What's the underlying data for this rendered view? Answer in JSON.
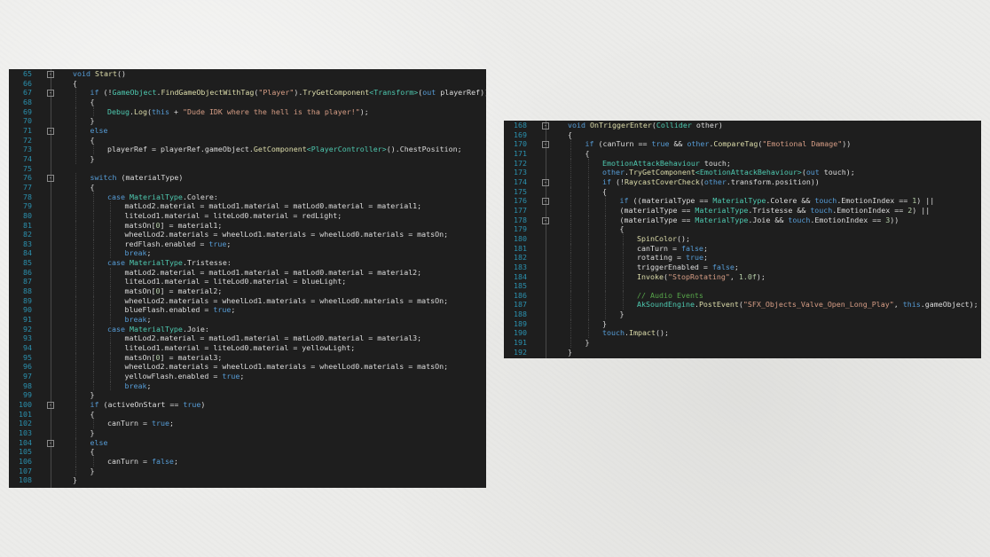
{
  "left_panel": {
    "lines": [
      {
        "n": "65",
        "indent": 0,
        "fold": "-",
        "tokens": [
          [
            "kw",
            "void "
          ],
          [
            "fn",
            "Start"
          ],
          [
            "pl",
            "()"
          ]
        ]
      },
      {
        "n": "66",
        "indent": 0,
        "tokens": [
          [
            "pl",
            "{"
          ]
        ]
      },
      {
        "n": "67",
        "indent": 1,
        "fold": "-",
        "tokens": [
          [
            "kw",
            "if "
          ],
          [
            "pl",
            "(!"
          ],
          [
            "ty",
            "GameObject"
          ],
          [
            "pl",
            "."
          ],
          [
            "fn",
            "FindGameObjectWithTag"
          ],
          [
            "pl",
            "("
          ],
          [
            "st",
            "\"Player\""
          ],
          [
            "pl",
            ")."
          ],
          [
            "fn",
            "TryGetComponent"
          ],
          [
            "ty",
            "<Transform>"
          ],
          [
            "pl",
            "("
          ],
          [
            "kw",
            "out "
          ],
          [
            "pl",
            "playerRef))"
          ]
        ]
      },
      {
        "n": "68",
        "indent": 1,
        "tokens": [
          [
            "pl",
            "{"
          ]
        ]
      },
      {
        "n": "69",
        "indent": 2,
        "tokens": [
          [
            "ty",
            "Debug"
          ],
          [
            "pl",
            "."
          ],
          [
            "fn",
            "Log"
          ],
          [
            "pl",
            "("
          ],
          [
            "kw",
            "this "
          ],
          [
            "pl",
            "+ "
          ],
          [
            "st",
            "\"Dude IDK where the hell is tha player!\""
          ],
          [
            "pl",
            ");"
          ]
        ]
      },
      {
        "n": "70",
        "indent": 1,
        "tokens": [
          [
            "pl",
            "}"
          ]
        ]
      },
      {
        "n": "71",
        "indent": 1,
        "fold": "-",
        "tokens": [
          [
            "kw",
            "else"
          ]
        ]
      },
      {
        "n": "72",
        "indent": 1,
        "tokens": [
          [
            "pl",
            "{"
          ]
        ]
      },
      {
        "n": "73",
        "indent": 2,
        "tokens": [
          [
            "pl",
            "playerRef = playerRef.gameObject."
          ],
          [
            "fn",
            "GetComponent"
          ],
          [
            "ty",
            "<PlayerController>"
          ],
          [
            "pl",
            "().ChestPosition;"
          ]
        ]
      },
      {
        "n": "74",
        "indent": 1,
        "tokens": [
          [
            "pl",
            "}"
          ]
        ]
      },
      {
        "n": "75",
        "indent": 0,
        "tokens": []
      },
      {
        "n": "76",
        "indent": 1,
        "fold": "-",
        "tokens": [
          [
            "kw",
            "switch "
          ],
          [
            "pl",
            "(materialType)"
          ]
        ]
      },
      {
        "n": "77",
        "indent": 1,
        "tokens": [
          [
            "pl",
            "{"
          ]
        ]
      },
      {
        "n": "78",
        "indent": 2,
        "tokens": [
          [
            "kw",
            "case "
          ],
          [
            "ty",
            "MaterialType"
          ],
          [
            "pl",
            ".Colere:"
          ]
        ]
      },
      {
        "n": "79",
        "indent": 3,
        "tokens": [
          [
            "pl",
            "matLod2.material = matLod1.material = matLod0.material = material1;"
          ]
        ]
      },
      {
        "n": "80",
        "indent": 3,
        "tokens": [
          [
            "pl",
            "liteLod1.material = liteLod0.material = redLight;"
          ]
        ]
      },
      {
        "n": "81",
        "indent": 3,
        "tokens": [
          [
            "pl",
            "matsOn["
          ],
          [
            "nm",
            "0"
          ],
          [
            "pl",
            "] = material1;"
          ]
        ]
      },
      {
        "n": "82",
        "indent": 3,
        "tokens": [
          [
            "pl",
            "wheelLod2.materials = wheelLod1.materials = wheelLod0.materials = matsOn;"
          ]
        ]
      },
      {
        "n": "83",
        "indent": 3,
        "tokens": [
          [
            "pl",
            "redFlash.enabled = "
          ],
          [
            "kw",
            "true"
          ],
          [
            "pl",
            ";"
          ]
        ]
      },
      {
        "n": "84",
        "indent": 3,
        "tokens": [
          [
            "kw",
            "break"
          ],
          [
            "pl",
            ";"
          ]
        ]
      },
      {
        "n": "85",
        "indent": 2,
        "tokens": [
          [
            "kw",
            "case "
          ],
          [
            "ty",
            "MaterialType"
          ],
          [
            "pl",
            ".Tristesse:"
          ]
        ]
      },
      {
        "n": "86",
        "indent": 3,
        "tokens": [
          [
            "pl",
            "matLod2.material = matLod1.material = matLod0.material = material2;"
          ]
        ]
      },
      {
        "n": "87",
        "indent": 3,
        "tokens": [
          [
            "pl",
            "liteLod1.material = liteLod0.material = blueLight;"
          ]
        ]
      },
      {
        "n": "88",
        "indent": 3,
        "tokens": [
          [
            "pl",
            "matsOn["
          ],
          [
            "nm",
            "0"
          ],
          [
            "pl",
            "] = material2;"
          ]
        ]
      },
      {
        "n": "89",
        "indent": 3,
        "tokens": [
          [
            "pl",
            "wheelLod2.materials = wheelLod1.materials = wheelLod0.materials = matsOn;"
          ]
        ]
      },
      {
        "n": "90",
        "indent": 3,
        "tokens": [
          [
            "pl",
            "blueFlash.enabled = "
          ],
          [
            "kw",
            "true"
          ],
          [
            "pl",
            ";"
          ]
        ]
      },
      {
        "n": "91",
        "indent": 3,
        "tokens": [
          [
            "kw",
            "break"
          ],
          [
            "pl",
            ";"
          ]
        ]
      },
      {
        "n": "92",
        "indent": 2,
        "tokens": [
          [
            "kw",
            "case "
          ],
          [
            "ty",
            "MaterialType"
          ],
          [
            "pl",
            ".Joie:"
          ]
        ]
      },
      {
        "n": "93",
        "indent": 3,
        "tokens": [
          [
            "pl",
            "matLod2.material = matLod1.material = matLod0.material = material3;"
          ]
        ]
      },
      {
        "n": "94",
        "indent": 3,
        "tokens": [
          [
            "pl",
            "liteLod1.material = liteLod0.material = yellowLight;"
          ]
        ]
      },
      {
        "n": "95",
        "indent": 3,
        "tokens": [
          [
            "pl",
            "matsOn["
          ],
          [
            "nm",
            "0"
          ],
          [
            "pl",
            "] = material3;"
          ]
        ]
      },
      {
        "n": "96",
        "indent": 3,
        "tokens": [
          [
            "pl",
            "wheelLod2.materials = wheelLod1.materials = wheelLod0.materials = matsOn;"
          ]
        ]
      },
      {
        "n": "97",
        "indent": 3,
        "tokens": [
          [
            "pl",
            "yellowFlash.enabled = "
          ],
          [
            "kw",
            "true"
          ],
          [
            "pl",
            ";"
          ]
        ]
      },
      {
        "n": "98",
        "indent": 3,
        "tokens": [
          [
            "kw",
            "break"
          ],
          [
            "pl",
            ";"
          ]
        ]
      },
      {
        "n": "99",
        "indent": 1,
        "tokens": [
          [
            "pl",
            "}"
          ]
        ]
      },
      {
        "n": "100",
        "indent": 1,
        "fold": "-",
        "tokens": [
          [
            "kw",
            "if "
          ],
          [
            "pl",
            "(activeOnStart == "
          ],
          [
            "kw",
            "true"
          ],
          [
            "pl",
            ")"
          ]
        ]
      },
      {
        "n": "101",
        "indent": 1,
        "tokens": [
          [
            "pl",
            "{"
          ]
        ]
      },
      {
        "n": "102",
        "indent": 2,
        "tokens": [
          [
            "pl",
            "canTurn = "
          ],
          [
            "kw",
            "true"
          ],
          [
            "pl",
            ";"
          ]
        ]
      },
      {
        "n": "103",
        "indent": 1,
        "tokens": [
          [
            "pl",
            "}"
          ]
        ]
      },
      {
        "n": "104",
        "indent": 1,
        "fold": "-",
        "tokens": [
          [
            "kw",
            "else"
          ]
        ]
      },
      {
        "n": "105",
        "indent": 1,
        "tokens": [
          [
            "pl",
            "{"
          ]
        ]
      },
      {
        "n": "106",
        "indent": 2,
        "tokens": [
          [
            "pl",
            "canTurn = "
          ],
          [
            "kw",
            "false"
          ],
          [
            "pl",
            ";"
          ]
        ]
      },
      {
        "n": "107",
        "indent": 1,
        "tokens": [
          [
            "pl",
            "}"
          ]
        ]
      },
      {
        "n": "108",
        "indent": 0,
        "tokens": [
          [
            "pl",
            "}"
          ]
        ]
      }
    ]
  },
  "right_panel": {
    "lines": [
      {
        "n": "168",
        "indent": 0,
        "fold": "-",
        "tokens": [
          [
            "kw",
            "void "
          ],
          [
            "fn",
            "OnTriggerEnter"
          ],
          [
            "pl",
            "("
          ],
          [
            "ty",
            "Collider "
          ],
          [
            "pl",
            "other)"
          ]
        ]
      },
      {
        "n": "169",
        "indent": 0,
        "tokens": [
          [
            "pl",
            "{"
          ]
        ]
      },
      {
        "n": "170",
        "indent": 1,
        "fold": "-",
        "tokens": [
          [
            "kw",
            "if "
          ],
          [
            "pl",
            "(canTurn == "
          ],
          [
            "kw",
            "true "
          ],
          [
            "pl",
            "&& "
          ],
          [
            "kw",
            "other"
          ],
          [
            "pl",
            "."
          ],
          [
            "fn",
            "CompareTag"
          ],
          [
            "pl",
            "("
          ],
          [
            "st",
            "\"Emotional Damage\""
          ],
          [
            "pl",
            "))"
          ]
        ]
      },
      {
        "n": "171",
        "indent": 1,
        "tokens": [
          [
            "pl",
            "{"
          ]
        ]
      },
      {
        "n": "172",
        "indent": 2,
        "tokens": [
          [
            "ty",
            "EmotionAttackBehaviour "
          ],
          [
            "pl",
            "touch;"
          ]
        ]
      },
      {
        "n": "173",
        "indent": 2,
        "tokens": [
          [
            "kw",
            "other"
          ],
          [
            "pl",
            "."
          ],
          [
            "fn",
            "TryGetComponent"
          ],
          [
            "ty",
            "<EmotionAttackBehaviour>"
          ],
          [
            "pl",
            "("
          ],
          [
            "kw",
            "out "
          ],
          [
            "pl",
            "touch);"
          ]
        ]
      },
      {
        "n": "174",
        "indent": 2,
        "fold": "-",
        "tokens": [
          [
            "kw",
            "if "
          ],
          [
            "pl",
            "(!"
          ],
          [
            "fn",
            "RaycastCoverCheck"
          ],
          [
            "pl",
            "("
          ],
          [
            "kw",
            "other"
          ],
          [
            "pl",
            ".transform.position))"
          ]
        ]
      },
      {
        "n": "175",
        "indent": 2,
        "tokens": [
          [
            "pl",
            "{"
          ]
        ]
      },
      {
        "n": "176",
        "indent": 3,
        "fold": "-",
        "tokens": [
          [
            "kw",
            "if "
          ],
          [
            "pl",
            "((materialType == "
          ],
          [
            "ty",
            "MaterialType"
          ],
          [
            "pl",
            ".Colere && "
          ],
          [
            "kw",
            "touch"
          ],
          [
            "pl",
            ".EmotionIndex == "
          ],
          [
            "nm",
            "1"
          ],
          [
            "pl",
            ") ||"
          ]
        ]
      },
      {
        "n": "177",
        "indent": 3,
        "tokens": [
          [
            "pl",
            "(materialType == "
          ],
          [
            "ty",
            "MaterialType"
          ],
          [
            "pl",
            ".Tristesse && "
          ],
          [
            "kw",
            "touch"
          ],
          [
            "pl",
            ".EmotionIndex == "
          ],
          [
            "nm",
            "2"
          ],
          [
            "pl",
            ") ||"
          ]
        ]
      },
      {
        "n": "178",
        "indent": 3,
        "fold": "-",
        "tokens": [
          [
            "pl",
            "(materialType == "
          ],
          [
            "ty",
            "MaterialType"
          ],
          [
            "pl",
            ".Joie && "
          ],
          [
            "kw",
            "touch"
          ],
          [
            "pl",
            ".EmotionIndex == "
          ],
          [
            "nm",
            "3"
          ],
          [
            "pl",
            "))"
          ]
        ]
      },
      {
        "n": "179",
        "indent": 3,
        "tokens": [
          [
            "pl",
            "{"
          ]
        ]
      },
      {
        "n": "180",
        "indent": 4,
        "tokens": [
          [
            "fn",
            "SpinColor"
          ],
          [
            "pl",
            "();"
          ]
        ]
      },
      {
        "n": "181",
        "indent": 4,
        "tokens": [
          [
            "pl",
            "canTurn = "
          ],
          [
            "kw",
            "false"
          ],
          [
            "pl",
            ";"
          ]
        ]
      },
      {
        "n": "182",
        "indent": 4,
        "tokens": [
          [
            "pl",
            "rotating = "
          ],
          [
            "kw",
            "true"
          ],
          [
            "pl",
            ";"
          ]
        ]
      },
      {
        "n": "183",
        "indent": 4,
        "tokens": [
          [
            "pl",
            "triggerEnabled = "
          ],
          [
            "kw",
            "false"
          ],
          [
            "pl",
            ";"
          ]
        ]
      },
      {
        "n": "184",
        "indent": 4,
        "tokens": [
          [
            "fn",
            "Invoke"
          ],
          [
            "pl",
            "("
          ],
          [
            "st",
            "\"StopRotating\""
          ],
          [
            "pl",
            ", "
          ],
          [
            "nm",
            "1.0f"
          ],
          [
            "pl",
            ");"
          ]
        ]
      },
      {
        "n": "185",
        "indent": 4,
        "tokens": []
      },
      {
        "n": "186",
        "indent": 4,
        "tokens": [
          [
            "cm",
            "// Audio Events"
          ]
        ]
      },
      {
        "n": "187",
        "indent": 4,
        "tokens": [
          [
            "ty",
            "AkSoundEngine"
          ],
          [
            "pl",
            "."
          ],
          [
            "fn",
            "PostEvent"
          ],
          [
            "pl",
            "("
          ],
          [
            "st",
            "\"SFX_Objects_Valve_Open_Long_Play\""
          ],
          [
            "pl",
            ", "
          ],
          [
            "kw",
            "this"
          ],
          [
            "pl",
            ".gameObject);"
          ]
        ]
      },
      {
        "n": "188",
        "indent": 3,
        "tokens": [
          [
            "pl",
            "}"
          ]
        ]
      },
      {
        "n": "189",
        "indent": 2,
        "tokens": [
          [
            "pl",
            "}"
          ]
        ]
      },
      {
        "n": "190",
        "indent": 2,
        "tokens": [
          [
            "kw",
            "touch"
          ],
          [
            "pl",
            "."
          ],
          [
            "fn",
            "Impact"
          ],
          [
            "pl",
            "();"
          ]
        ]
      },
      {
        "n": "191",
        "indent": 1,
        "tokens": [
          [
            "pl",
            "}"
          ]
        ]
      },
      {
        "n": "192",
        "indent": 0,
        "tokens": [
          [
            "pl",
            "}"
          ]
        ]
      }
    ]
  },
  "colors": {
    "editor_background": "#1e1e1e",
    "line_number": "#2b91af",
    "keyword": "#569cd6",
    "type": "#4ec9b0",
    "method": "#dcdcaa",
    "string": "#d69d85",
    "comment": "#57a64a",
    "number": "#b5cea8",
    "plain": "#dcdcdc",
    "page_background": "#ececea"
  },
  "icons": {
    "fold_marker": "collapse-minus-icon"
  }
}
